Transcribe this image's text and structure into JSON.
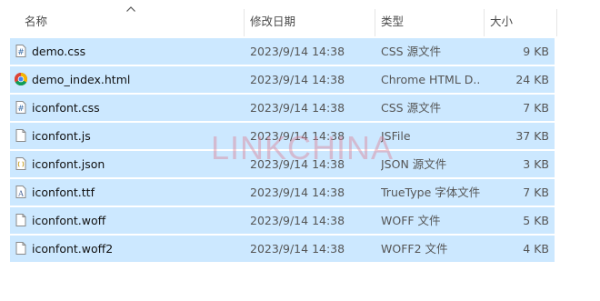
{
  "columns": {
    "name": "名称",
    "date": "修改日期",
    "type": "类型",
    "size": "大小"
  },
  "sort_icon": "chevron-up-icon",
  "files": [
    {
      "name": "demo.css",
      "date": "2023/9/14 14:38",
      "type": "CSS 源文件",
      "size": "9 KB",
      "icon": "css-file-icon"
    },
    {
      "name": "demo_index.html",
      "date": "2023/9/14 14:38",
      "type": "Chrome HTML D...",
      "size": "24 KB",
      "icon": "chrome-icon"
    },
    {
      "name": "iconfont.css",
      "date": "2023/9/14 14:38",
      "type": "CSS 源文件",
      "size": "7 KB",
      "icon": "css-file-icon"
    },
    {
      "name": "iconfont.js",
      "date": "2023/9/14 14:38",
      "type": "JSFile",
      "size": "37 KB",
      "icon": "file-icon"
    },
    {
      "name": "iconfont.json",
      "date": "2023/9/14 14:38",
      "type": "JSON 源文件",
      "size": "3 KB",
      "icon": "json-file-icon"
    },
    {
      "name": "iconfont.ttf",
      "date": "2023/9/14 14:38",
      "type": "TrueType 字体文件",
      "size": "7 KB",
      "icon": "font-file-icon"
    },
    {
      "name": "iconfont.woff",
      "date": "2023/9/14 14:38",
      "type": "WOFF 文件",
      "size": "5 KB",
      "icon": "file-icon"
    },
    {
      "name": "iconfont.woff2",
      "date": "2023/9/14 14:38",
      "type": "WOFF2 文件",
      "size": "4 KB",
      "icon": "file-icon"
    }
  ],
  "watermark": "LINKCHINA",
  "colors": {
    "selection": "#cce8ff",
    "watermark": "#dc8296"
  }
}
